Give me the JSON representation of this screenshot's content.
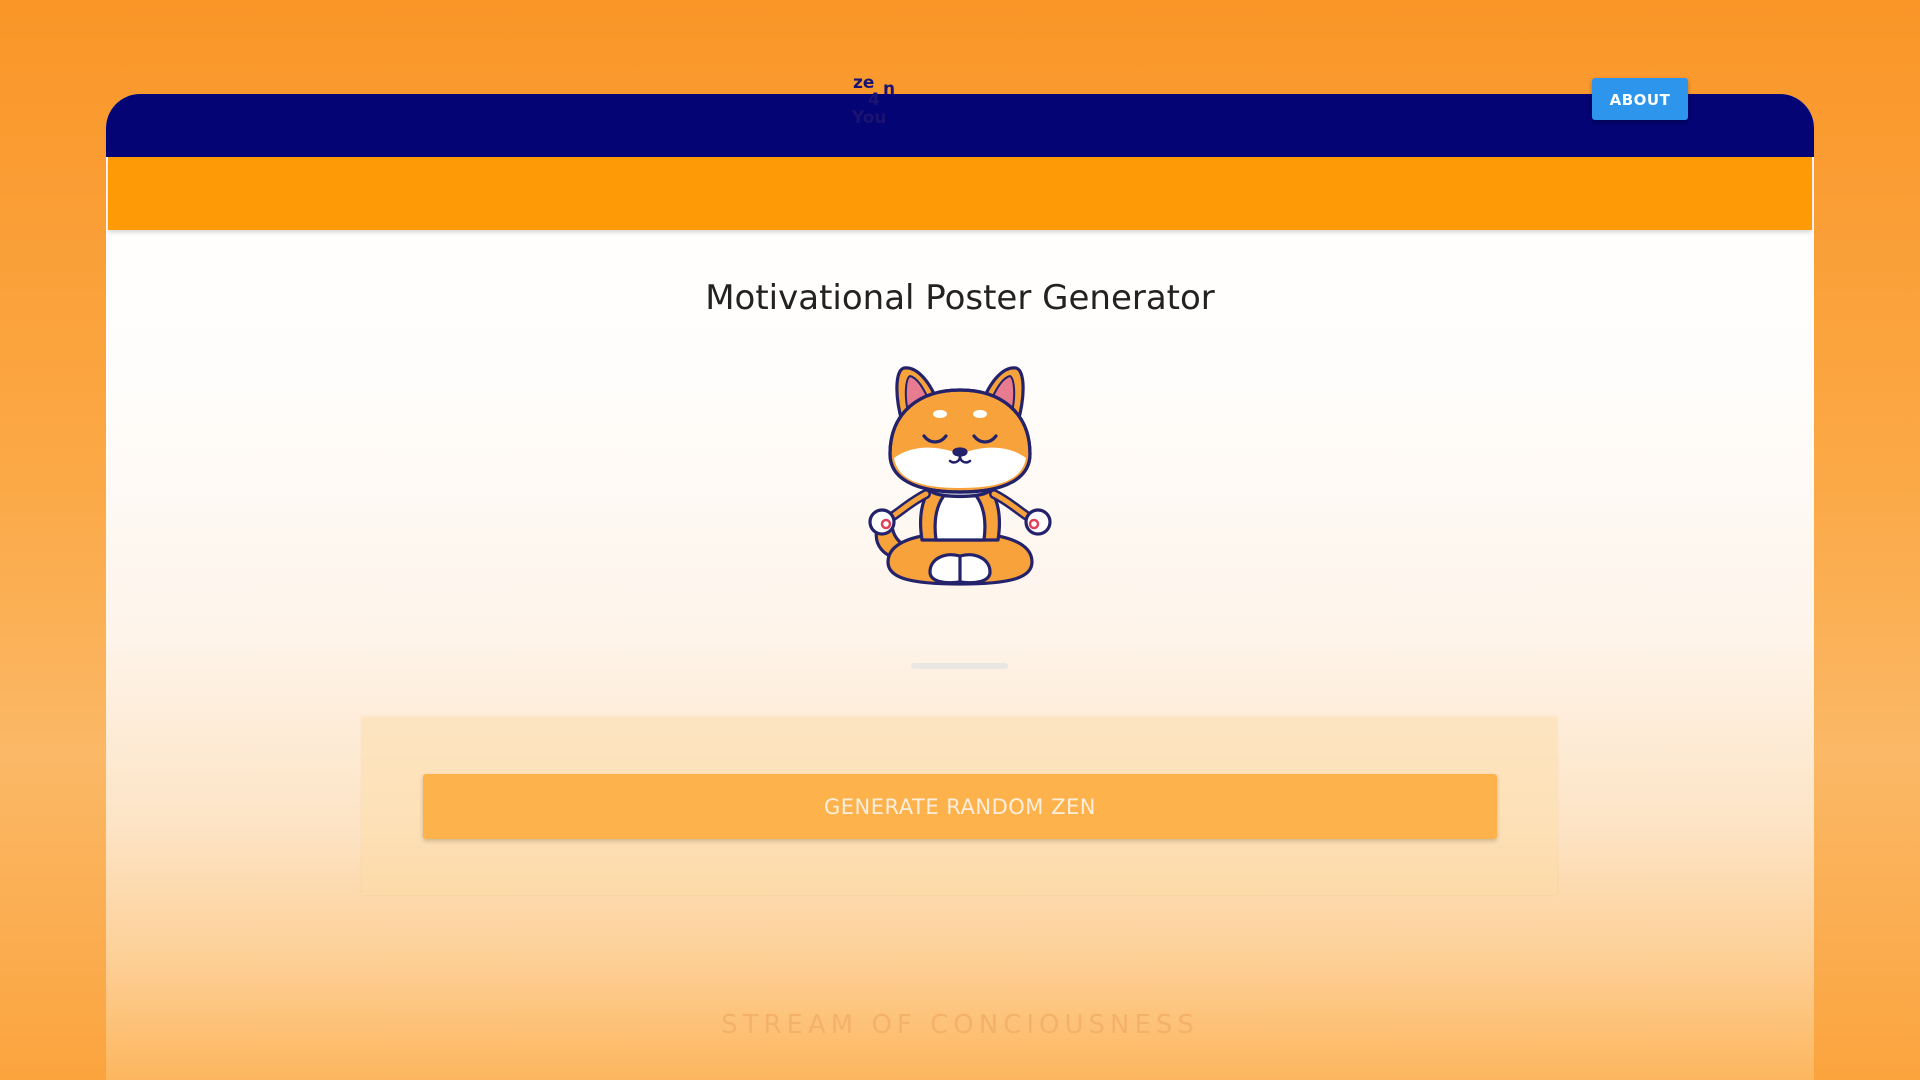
{
  "header": {
    "logo_text": [
      "ze",
      "n",
      "4",
      "You"
    ],
    "about_label": "ABOUT"
  },
  "main": {
    "title": "Motivational Poster Generator",
    "generate_label": "GENERATE RANDOM ZEN",
    "footer_text": "STREAM OF CONCIOUSNESS"
  },
  "colors": {
    "browser_bar": "#050474",
    "nav_bar": "#ff9a07",
    "about_button": "#2d95ec",
    "generate_button": "#fdb24c",
    "logo_ink": "#1a1372"
  },
  "icons": {
    "logo": "zen-4-you-logo",
    "mascot": "meditating-shiba-dog"
  }
}
